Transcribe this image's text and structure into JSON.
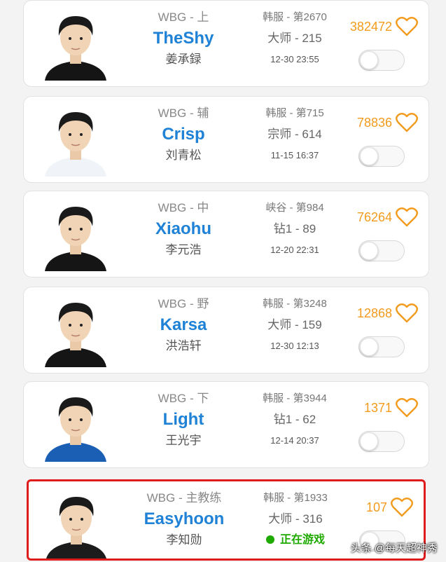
{
  "players": [
    {
      "team": "WBG - 上",
      "name": "TheShy",
      "realname": "姜承録",
      "server": "韩服 - 第2670",
      "tier": "大师 - 215",
      "time": "12-30 23:55",
      "likes": "382472",
      "live": false,
      "jersey": "#151515"
    },
    {
      "team": "WBG - 辅",
      "name": "Crisp",
      "realname": "刘青松",
      "server": "韩服 - 第715",
      "tier": "宗师 - 614",
      "time": "11-15 16:37",
      "likes": "78836",
      "live": false,
      "jersey": "#f0f4f8"
    },
    {
      "team": "WBG - 中",
      "name": "Xiaohu",
      "realname": "李元浩",
      "server": "峡谷 - 第984",
      "tier": "钻1 - 89",
      "time": "12-20 22:31",
      "likes": "76264",
      "live": false,
      "jersey": "#151515"
    },
    {
      "team": "WBG - 野",
      "name": "Karsa",
      "realname": "洪浩轩",
      "server": "韩服 - 第3248",
      "tier": "大师 - 159",
      "time": "12-30 12:13",
      "likes": "12868",
      "live": false,
      "jersey": "#151515"
    },
    {
      "team": "WBG - 下",
      "name": "Light",
      "realname": "王光宇",
      "server": "韩服 - 第3944",
      "tier": "钻1 - 62",
      "time": "12-14 20:37",
      "likes": "1371",
      "live": false,
      "jersey": "#1a5fb4"
    },
    {
      "team": "WBG - 主教练",
      "name": "Easyhoon",
      "realname": "李知勋",
      "server": "韩服 - 第1933",
      "tier": "大师 - 316",
      "time": "",
      "status": "正在游戏",
      "likes": "107",
      "live": true,
      "jersey": "#1c1c1c"
    }
  ],
  "watermark": "头条 @每天超神秀",
  "colors": {
    "accent": "#1f82d6",
    "likes": "#f29b1c",
    "live": "#1faa00",
    "highlight": "#e01b1b"
  },
  "icons": {
    "like": "heart-outline-icon",
    "status": "green-dot-icon"
  }
}
